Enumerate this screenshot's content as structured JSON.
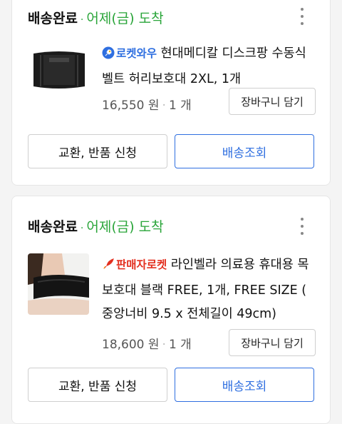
{
  "orders": [
    {
      "status": "배송완료",
      "separator": "·",
      "arrival": "어제(금) 도착",
      "badge": "로켓와우",
      "badge_color": "#2f6fe0",
      "product_name": "현대메디칼 디스크팡 수동식벨트 허리보호대 2XL, 1개",
      "price": "16,550 원",
      "qty": "1 개",
      "cart_label": "장바구니 담기",
      "exchange_label": "교환, 반품 신청",
      "track_label": "배송조회"
    },
    {
      "status": "배송완료",
      "separator": "·",
      "arrival": "어제(금) 도착",
      "badge": "판매자로켓",
      "badge_color": "#e32f1f",
      "product_name": "라인벨라 의료용 휴대용 목 보호대 블랙 FREE, 1개, FREE SIZE ( 중앙너비 9.5 x 전체길이 49cm)",
      "price": "18,600 원",
      "qty": "1 개",
      "cart_label": "장바구니 담기",
      "exchange_label": "교환, 반품 신청",
      "track_label": "배송조회"
    }
  ],
  "colors": {
    "accent_green": "#2aa53a",
    "accent_blue": "#2f6fe0",
    "seller_red": "#e32f1f"
  },
  "icons": [
    "more-vert-icon",
    "rocket-icon",
    "product-thumbnail"
  ]
}
